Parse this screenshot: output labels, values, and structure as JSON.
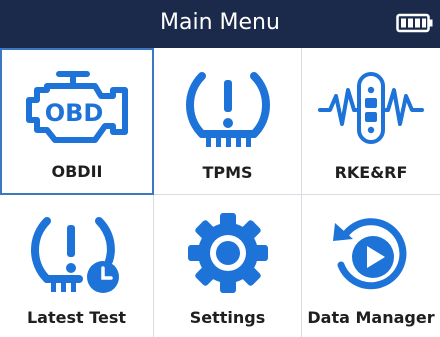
{
  "header": {
    "title": "Main Menu",
    "battery_icon": "battery-full-icon"
  },
  "colors": {
    "header_bg": "#1b2a4a",
    "icon_blue": "#1e73d8",
    "selected_border": "#3a78c2"
  },
  "menu": [
    {
      "label": "OBDII",
      "icon": "engine-obd-icon",
      "icon_text": "OBD",
      "selected": true
    },
    {
      "label": "TPMS",
      "icon": "tire-pressure-icon",
      "selected": false
    },
    {
      "label": "RKE&RF",
      "icon": "key-fob-signal-icon",
      "selected": false
    },
    {
      "label": "Latest Test",
      "icon": "tire-pressure-clock-icon",
      "selected": false
    },
    {
      "label": "Settings",
      "icon": "gear-icon",
      "selected": false
    },
    {
      "label": "Data Manager",
      "icon": "replay-icon",
      "selected": false
    }
  ]
}
